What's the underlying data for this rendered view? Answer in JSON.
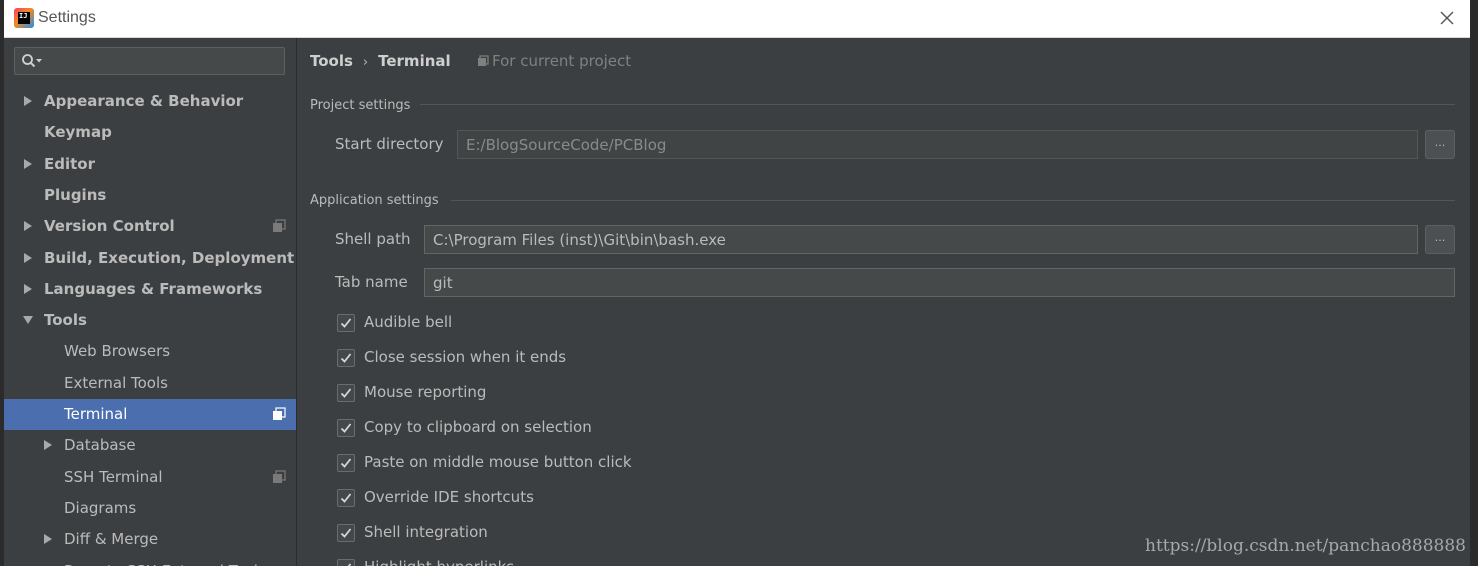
{
  "window": {
    "title": "Settings",
    "app_icon_text": "IJ"
  },
  "sidebar": {
    "search": {
      "value": "",
      "placeholder": ""
    },
    "items": [
      {
        "label": "Appearance & Behavior",
        "level": 0,
        "expandable": true,
        "expanded": false,
        "project_icon": false,
        "selected": false
      },
      {
        "label": "Keymap",
        "level": 0,
        "expandable": false,
        "expanded": false,
        "project_icon": false,
        "selected": false
      },
      {
        "label": "Editor",
        "level": 0,
        "expandable": true,
        "expanded": false,
        "project_icon": false,
        "selected": false
      },
      {
        "label": "Plugins",
        "level": 0,
        "expandable": false,
        "expanded": false,
        "project_icon": false,
        "selected": false
      },
      {
        "label": "Version Control",
        "level": 0,
        "expandable": true,
        "expanded": false,
        "project_icon": true,
        "selected": false
      },
      {
        "label": "Build, Execution, Deployment",
        "level": 0,
        "expandable": true,
        "expanded": false,
        "project_icon": false,
        "selected": false
      },
      {
        "label": "Languages & Frameworks",
        "level": 0,
        "expandable": true,
        "expanded": false,
        "project_icon": false,
        "selected": false
      },
      {
        "label": "Tools",
        "level": 0,
        "expandable": true,
        "expanded": true,
        "project_icon": false,
        "selected": false
      },
      {
        "label": "Web Browsers",
        "level": 1,
        "expandable": false,
        "expanded": false,
        "project_icon": false,
        "selected": false
      },
      {
        "label": "External Tools",
        "level": 1,
        "expandable": false,
        "expanded": false,
        "project_icon": false,
        "selected": false
      },
      {
        "label": "Terminal",
        "level": 1,
        "expandable": false,
        "expanded": false,
        "project_icon": true,
        "selected": true
      },
      {
        "label": "Database",
        "level": 1,
        "expandable": true,
        "expanded": false,
        "project_icon": false,
        "selected": false
      },
      {
        "label": "SSH Terminal",
        "level": 1,
        "expandable": false,
        "expanded": false,
        "project_icon": true,
        "selected": false
      },
      {
        "label": "Diagrams",
        "level": 1,
        "expandable": false,
        "expanded": false,
        "project_icon": false,
        "selected": false
      },
      {
        "label": "Diff & Merge",
        "level": 1,
        "expandable": true,
        "expanded": false,
        "project_icon": false,
        "selected": false
      },
      {
        "label": "Remote SSH External Tools",
        "level": 1,
        "expandable": false,
        "expanded": false,
        "project_icon": false,
        "selected": false
      }
    ]
  },
  "breadcrumb": {
    "parent": "Tools",
    "separator": "›",
    "current": "Terminal",
    "scope": "For current project"
  },
  "project_settings": {
    "heading": "Project settings",
    "start_directory_label": "Start directory",
    "start_directory_value": "E:/BlogSourceCode/PCBlog",
    "browse_label": "..."
  },
  "application_settings": {
    "heading": "Application settings",
    "shell_path_label": "Shell path",
    "shell_path_value": "C:\\Program Files (inst)\\Git\\bin\\bash.exe",
    "browse_label": "...",
    "tab_name_label": "Tab name",
    "tab_name_value": "git"
  },
  "checkboxes": [
    {
      "label": "Audible bell",
      "checked": true
    },
    {
      "label": "Close session when it ends",
      "checked": true
    },
    {
      "label": "Mouse reporting",
      "checked": true
    },
    {
      "label": "Copy to clipboard on selection",
      "checked": true
    },
    {
      "label": "Paste on middle mouse button click",
      "checked": true
    },
    {
      "label": "Override IDE shortcuts",
      "checked": true
    },
    {
      "label": "Shell integration",
      "checked": true
    },
    {
      "label": "Highlight hyperlinks",
      "checked": true
    }
  ],
  "watermark": "https://blog.csdn.net/panchao888888",
  "colors": {
    "background": "#3c3f41",
    "selection": "#4b6eaf",
    "text": "#bbbbbb",
    "titlebar": "#ffffff"
  },
  "icons": {
    "close": "close-icon",
    "search": "search-icon",
    "expand": "chevron-right-icon",
    "collapse": "chevron-down-icon",
    "project": "project-scope-icon",
    "check": "checkmark-icon"
  }
}
